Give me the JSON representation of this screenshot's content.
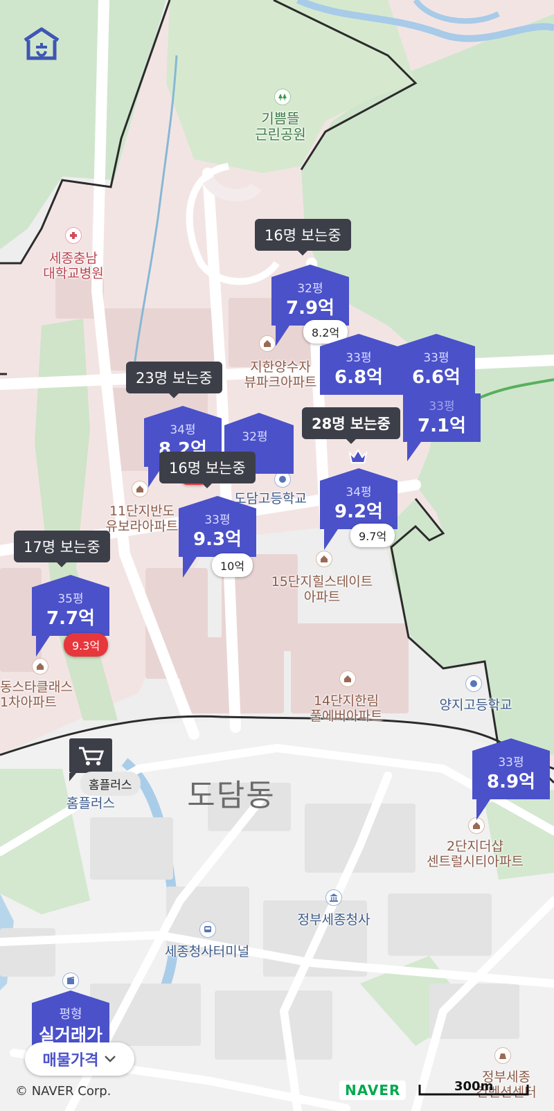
{
  "map": {
    "home_icon": "home-icon",
    "labels": {
      "park": [
        "기쁨뜰",
        "근린공원"
      ],
      "hospital": [
        "세종충남",
        "대학교병원"
      ],
      "apt_yangsu": [
        "지한양수자",
        "뷰파크아파트"
      ],
      "apt_11": [
        "11단지반도",
        "유보라아파트"
      ],
      "school_dodam": "도담고등학교",
      "apt_15": [
        "15단지힐스테이트",
        "아파트"
      ],
      "apt_left": [
        "동스타클래스",
        "1차아파트"
      ],
      "apt_14": [
        "14단지한림",
        "풀에버아파트"
      ],
      "school_yangji": "양지고등학교",
      "mart": "홈플러스",
      "mart_badge": "홈플러스",
      "dong": "도담동",
      "apt_2": [
        "2단지더샵",
        "센트럴시티아파트"
      ],
      "gov": "정부세종청사",
      "terminal": "세종청사터미널",
      "convention": [
        "정부세종",
        "컨벤션센터"
      ]
    }
  },
  "markers": [
    {
      "id": "m1",
      "pyeong": "32평",
      "price": "7.9억",
      "badge": "8.2억",
      "badge_color": "white"
    },
    {
      "id": "m2",
      "pyeong": "33평",
      "price": "6.8억",
      "badge": "",
      "badge_color": "white"
    },
    {
      "id": "m3",
      "pyeong": "33평",
      "price": "6.6억",
      "badge": "",
      "badge_color": "white"
    },
    {
      "id": "m4",
      "pyeong": "33평",
      "price": "7.1억",
      "badge": "",
      "badge_color": "white"
    },
    {
      "id": "m5",
      "pyeong": "34평",
      "price": "8.2억",
      "badge": "",
      "badge_color": "red"
    },
    {
      "id": "m6",
      "pyeong": "32평",
      "price": "",
      "badge": "",
      "badge_color": "white"
    },
    {
      "id": "m7",
      "pyeong": "33평",
      "price": "9.3억",
      "badge": "10억",
      "badge_color": "white"
    },
    {
      "id": "m8",
      "pyeong": "34평",
      "price": "9.2억",
      "badge": "9.7억",
      "badge_color": "white"
    },
    {
      "id": "m9",
      "pyeong": "35평",
      "price": "7.7억",
      "badge": "9.3억",
      "badge_color": "red"
    },
    {
      "id": "m10",
      "pyeong": "33평",
      "price": "8.9억",
      "badge": "",
      "badge_color": "white"
    }
  ],
  "viewers": [
    {
      "id": "v1",
      "text": "16명 보는중"
    },
    {
      "id": "v2",
      "text": "23명 보는중"
    },
    {
      "id": "v3",
      "text": "28명 보는중"
    },
    {
      "id": "v4",
      "text": "16명 보는중"
    },
    {
      "id": "v5",
      "text": "17명 보는중"
    }
  ],
  "controls": {
    "area_toggle_top": "평형",
    "area_toggle_bottom": "실거래가",
    "listing_price": "매물가격",
    "copyright": "© NAVER Corp.",
    "naver_logo": "NAVER",
    "scale": "300m"
  },
  "colors": {
    "marker": "#4b51c9",
    "viewer_bubble": "#3d3f48",
    "badge_red": "#e8363d",
    "boundary": "#2b2b2b"
  }
}
